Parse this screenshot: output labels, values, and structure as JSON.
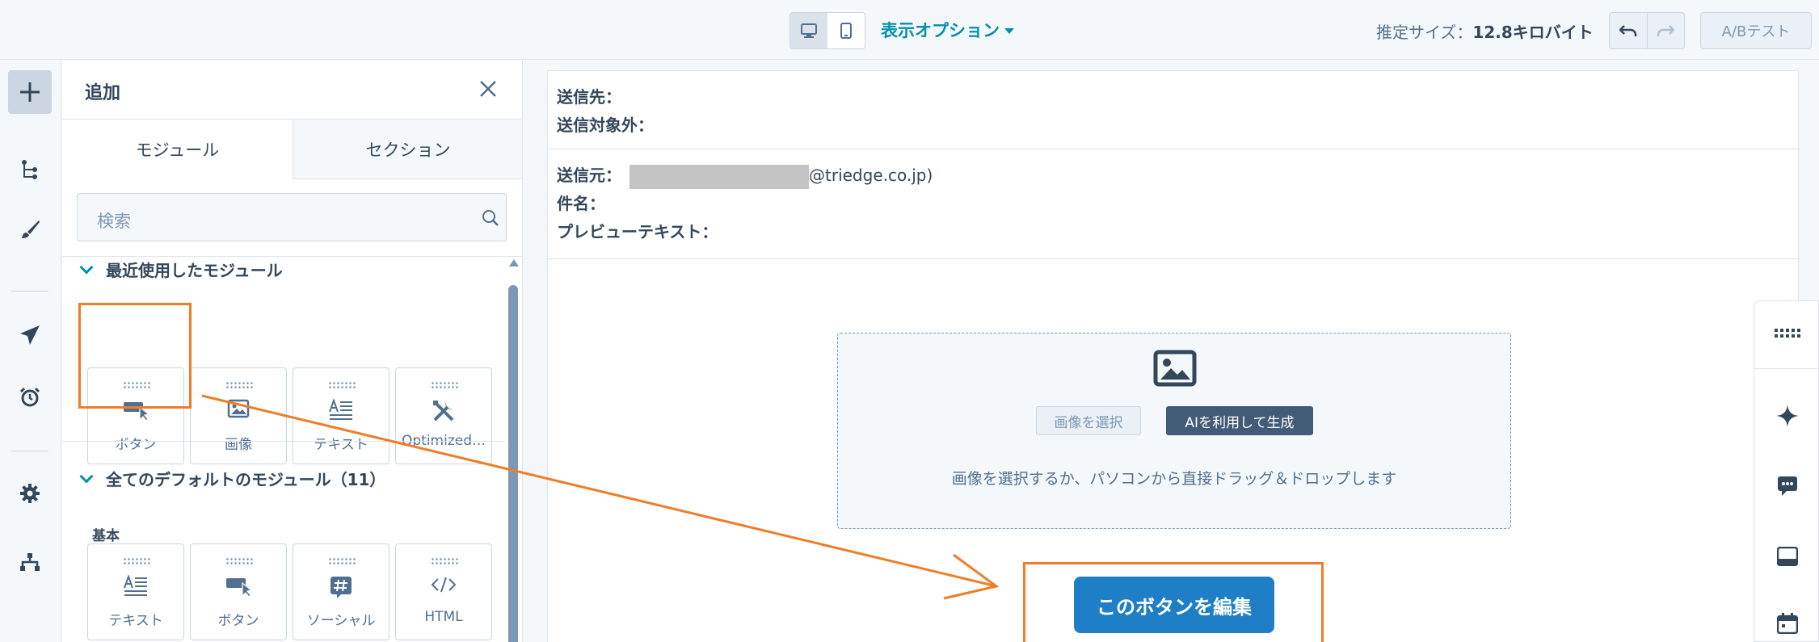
{
  "colors": {
    "accent": "#0091ae",
    "highlight": "#f07d26",
    "primary_button": "#1e7fc6",
    "dark_button": "#425b76",
    "text": "#33475b",
    "muted": "#7c98b6"
  },
  "topbar": {
    "view_options_label": "表示オプション",
    "size_label": "推定サイズ：",
    "size_value": "12.8キロバイト",
    "ab_test_label": "A/Bテスト",
    "icons": [
      "desktop-icon",
      "mobile-icon",
      "undo-icon",
      "redo-icon"
    ]
  },
  "left_rail": {
    "icons": [
      "plus-icon",
      "tree-icon",
      "brush-icon",
      "send-icon",
      "alarm-icon",
      "gear-icon",
      "sitemap-icon"
    ]
  },
  "panel": {
    "title": "追加",
    "tabs": [
      {
        "label": "モジュール",
        "active": true
      },
      {
        "label": "セクション",
        "active": false
      }
    ],
    "search_placeholder": "検索",
    "recent_section": {
      "title": "最近使用したモジュール",
      "modules": [
        {
          "label": "ボタン",
          "icon": "button-icon"
        },
        {
          "label": "画像",
          "icon": "image-icon"
        },
        {
          "label": "テキスト",
          "icon": "text-icon"
        },
        {
          "label": "Optimized…",
          "icon": "tools-icon"
        }
      ]
    },
    "default_section": {
      "title": "全てのデフォルトのモジュール（11）",
      "sub_label": "基本",
      "modules": [
        {
          "label": "テキスト",
          "icon": "text-icon"
        },
        {
          "label": "ボタン",
          "icon": "button-icon"
        },
        {
          "label": "ソーシャル",
          "icon": "hashtag-icon"
        },
        {
          "label": "HTML",
          "icon": "code-icon"
        }
      ]
    }
  },
  "email": {
    "to_label": "送信先：",
    "exclude_label": "送信対象外：",
    "from_label": "送信元：",
    "from_domain": "@triedge.co.jp)",
    "subject_label": "件名：",
    "preview_label": "プレビューテキスト：",
    "image_module": {
      "select_label": "画像を選択",
      "ai_label": "AIを利用して生成",
      "hint": "画像を選択するか、パソコンから直接ドラッグ＆ドロップします"
    },
    "edit_button_label": "このボタンを編集"
  },
  "right_rail": {
    "icons": [
      "grid-dots-icon",
      "sparkle-icon",
      "chat-icon",
      "window-icon",
      "calendar-icon"
    ]
  }
}
